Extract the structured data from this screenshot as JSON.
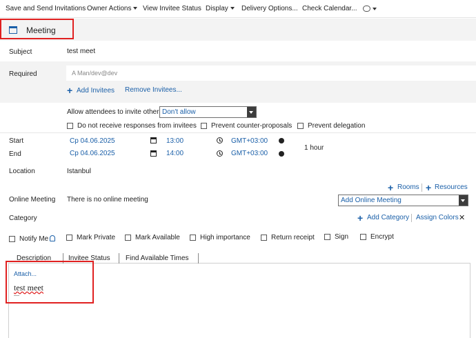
{
  "toolbar": {
    "save_send": "Save and Send Invitations",
    "owner_actions": "Owner Actions",
    "view_status": "View Invitee Status",
    "display": "Display",
    "delivery": "Delivery Options...",
    "check_calendar": "Check Calendar..."
  },
  "form": {
    "title": "Meeting"
  },
  "subject": {
    "label": "Subject",
    "value": "test meet"
  },
  "required": {
    "label": "Required",
    "placeholder": "A Man/dev@dev",
    "add_invitees": "Add Invitees",
    "remove_invitees": "Remove Invitees..."
  },
  "invite_options": {
    "allow_label": "Allow attendees to invite others",
    "allow_value": "Don't allow",
    "no_responses": "Do not receive responses from invitees",
    "prevent_counter": "Prevent counter-proposals",
    "prevent_delegation": "Prevent delegation"
  },
  "start": {
    "label": "Start",
    "date": "Ср 04.06.2025",
    "time": "13:00",
    "tz": "GMT+03:00"
  },
  "end": {
    "label": "End",
    "date": "Ср 04.06.2025",
    "time": "14:00",
    "tz": "GMT+03:00"
  },
  "duration": "1 hour",
  "location": {
    "label": "Location",
    "value": "Istanbul"
  },
  "rooms": {
    "rooms": "Rooms",
    "resources": "Resources"
  },
  "online": {
    "label": "Online Meeting",
    "value": "There is no online meeting",
    "select_value": "Add Online Meeting"
  },
  "category": {
    "label": "Category",
    "add": "Add Category",
    "assign_colors": "Assign Colors",
    "close": "✕"
  },
  "flags": {
    "notify_me": "Notify Me",
    "mark_private": "Mark Private",
    "mark_available": "Mark Available",
    "high_importance": "High importance",
    "return_receipt": "Return receipt",
    "sign": "Sign",
    "encrypt": "Encrypt"
  },
  "tabs": [
    "Description",
    "Invitee Status",
    "Find Available Times"
  ],
  "body": {
    "attach": "Attach...",
    "text": "test meet"
  },
  "colors": {
    "accent": "#1a5fa8",
    "highlight": "#e02020",
    "band": "#f3f3f3"
  }
}
